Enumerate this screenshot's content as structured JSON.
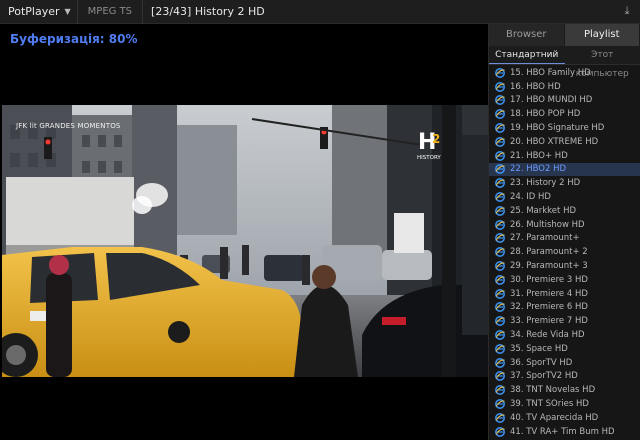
{
  "titlebar": {
    "app_name": "PotPlayer",
    "format": "MPEG TS",
    "title": "[23/43] History 2 HD"
  },
  "osd": {
    "buffering": "Буферизація: 80%"
  },
  "video": {
    "ticker": "JFK lit GRANDES MOMENTOS",
    "channel_logo": "HISTORY"
  },
  "panel": {
    "tabs": [
      {
        "label": "Browser"
      },
      {
        "label": "Playlist"
      }
    ],
    "subtabs": [
      {
        "label": "Стандартний"
      },
      {
        "label": "Этот компьютер"
      }
    ]
  },
  "playlist": {
    "current_index": 7,
    "items": [
      {
        "label": "15. HBO Family HD"
      },
      {
        "label": "16. HBO HD"
      },
      {
        "label": "17. HBO MUNDI HD"
      },
      {
        "label": "18. HBO POP HD"
      },
      {
        "label": "19. HBO Signature HD"
      },
      {
        "label": "20. HBO XTREME HD"
      },
      {
        "label": "21. HBO+ HD"
      },
      {
        "label": "22. HBO2 HD"
      },
      {
        "label": "23. History 2 HD"
      },
      {
        "label": "24. ID HD"
      },
      {
        "label": "25. Markket HD"
      },
      {
        "label": "26. Multishow HD"
      },
      {
        "label": "27. Paramount+"
      },
      {
        "label": "28. Paramount+ 2"
      },
      {
        "label": "29. Paramount+ 3"
      },
      {
        "label": "30. Premiere 3 HD"
      },
      {
        "label": "31. Premiere 4 HD"
      },
      {
        "label": "32. Premiere 6 HD"
      },
      {
        "label": "33. Premiere 7 HD"
      },
      {
        "label": "34. Rede Vida HD"
      },
      {
        "label": "35. Space HD"
      },
      {
        "label": "36. SporTV HD"
      },
      {
        "label": "37. SporTV2 HD"
      },
      {
        "label": "38. TNT Novelas HD"
      },
      {
        "label": "39. TNT SOries HD"
      },
      {
        "label": "40. TV Aparecida HD"
      },
      {
        "label": "41. TV RA+ Tim Bum HD"
      }
    ]
  },
  "colors": {
    "accent": "#4f7cf0",
    "current_item": "#6f9bff",
    "taxi": "#e9b22a"
  }
}
